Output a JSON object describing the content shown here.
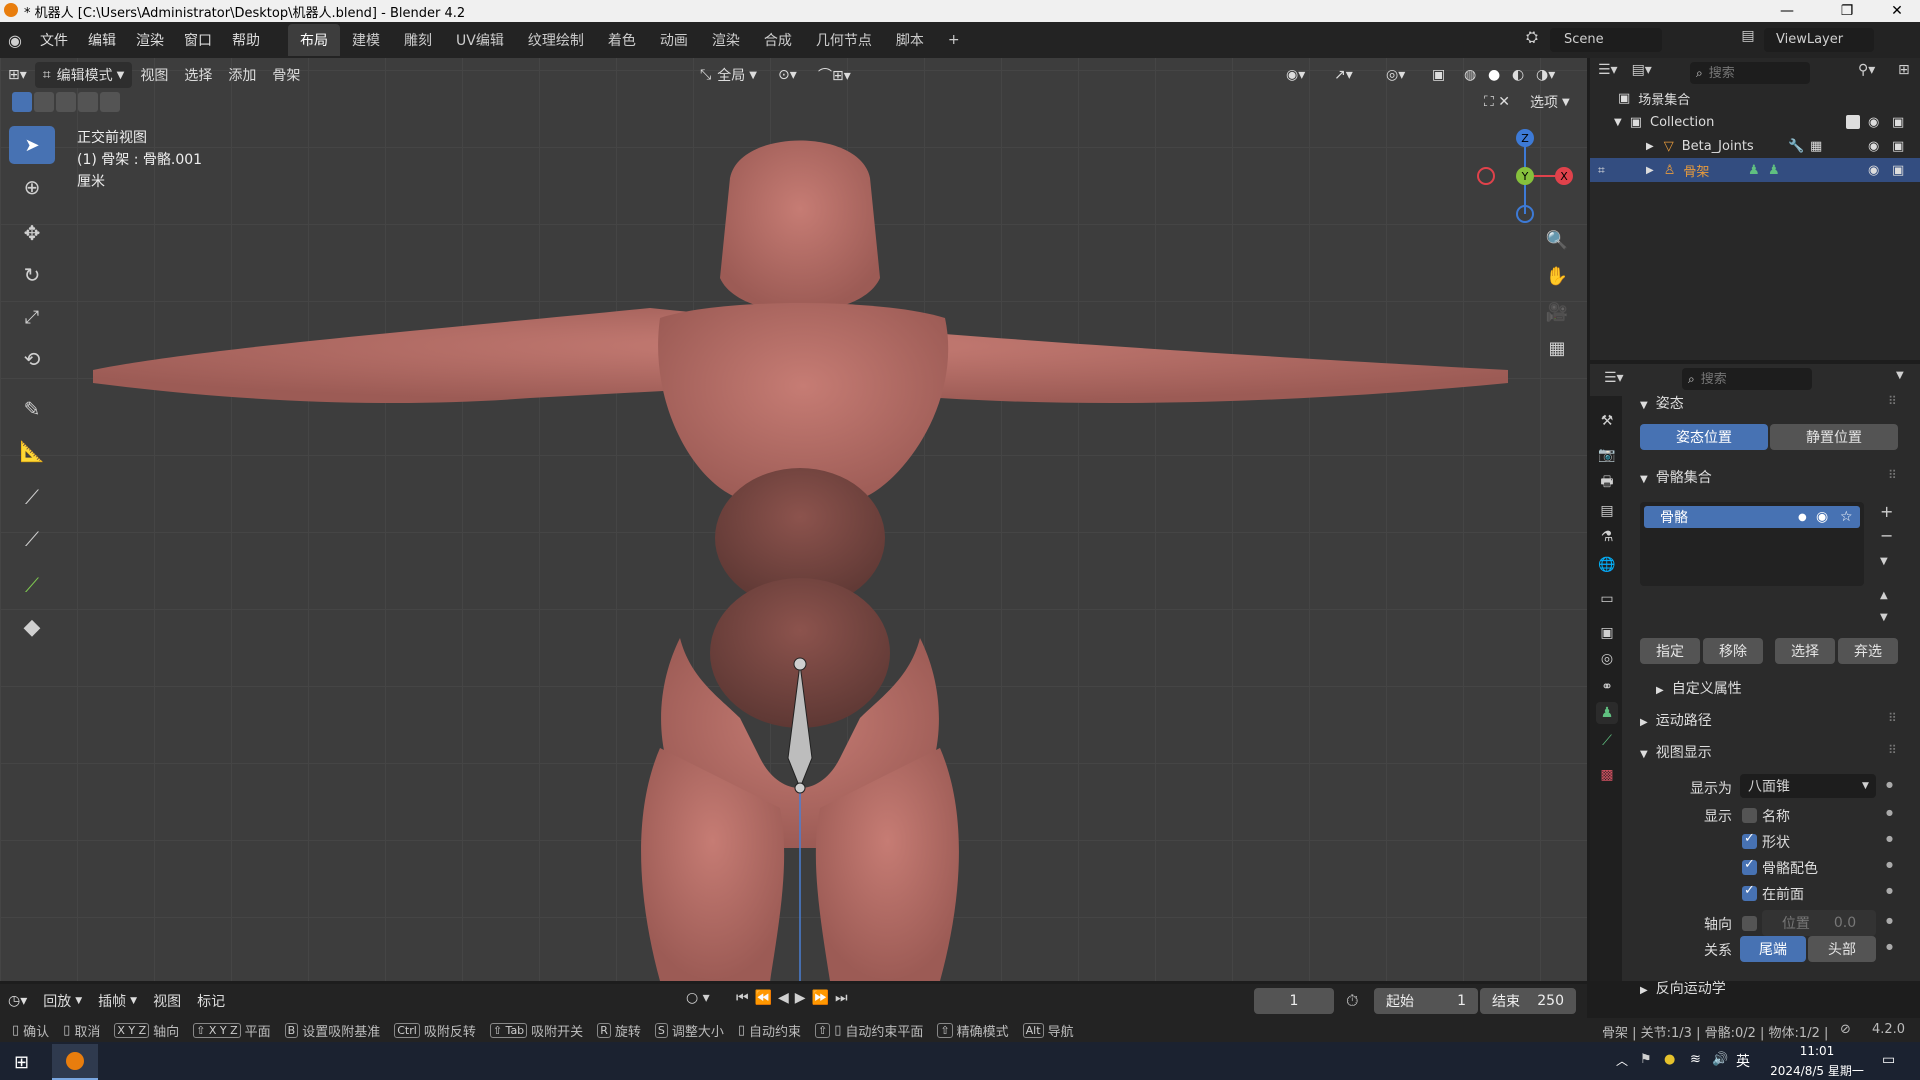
{
  "window": {
    "title": "* 机器人 [C:\\Users\\Administrator\\Desktop\\机器人.blend] - Blender 4.2",
    "min": "—",
    "max": "❐",
    "close": "✕"
  },
  "menus": [
    "文件",
    "编辑",
    "渲染",
    "窗口",
    "帮助"
  ],
  "workspaces": [
    "布局",
    "建模",
    "雕刻",
    "UV编辑",
    "纹理绘制",
    "着色",
    "动画",
    "渲染",
    "合成",
    "几何节点",
    "脚本"
  ],
  "workspace_add": "+",
  "scene": {
    "scene_name": "Scene",
    "view_layer": "ViewLayer"
  },
  "viewport_header": {
    "mode": "编辑模式",
    "menus": [
      "视图",
      "选择",
      "添加",
      "骨架"
    ],
    "transform_orientation": "全局",
    "options": "选项"
  },
  "viewport_info": {
    "view": "正交前视图",
    "selection": "(1) 骨架 : 骨骼.001",
    "units": "厘米"
  },
  "gizmo_axes": {
    "z": "Z",
    "y": "Y",
    "x": "X"
  },
  "outliner": {
    "search_placeholder": "搜索",
    "root": "场景集合",
    "collection": "Collection",
    "items": [
      {
        "name": "Beta_Joints",
        "type": "mesh"
      },
      {
        "name": "骨架",
        "type": "armature",
        "selected": true
      }
    ]
  },
  "properties": {
    "search_placeholder": "搜索",
    "pose_section": "姿态",
    "pose_position": "姿态位置",
    "rest_position": "静置位置",
    "bone_collections_section": "骨骼集合",
    "bone_collection_item": "骨骼",
    "assign": "指定",
    "remove": "移除",
    "select": "选择",
    "deselect": "弃选",
    "custom_props": "自定义属性",
    "motion_paths": "运动路径",
    "viewport_display": "视图显示",
    "display_as_label": "显示为",
    "display_as_value": "八面锥",
    "show_label": "显示",
    "show_names": "名称",
    "show_shapes": "形状",
    "show_bone_colors": "骨骼配色",
    "in_front": "在前面",
    "axes_label": "轴向",
    "axes_position_label": "位置",
    "axes_position_value": "0.0",
    "relation_label": "关系",
    "relation_tail": "尾端",
    "relation_head": "头部",
    "inverse_kinematics": "反向运动学",
    "checkboxes": {
      "names": false,
      "shapes": true,
      "bone_colors": true,
      "in_front": true,
      "axes": false
    }
  },
  "timeline": {
    "menus": [
      "回放",
      "插帧",
      "视图",
      "标记"
    ],
    "current_frame": "1",
    "start_label": "起始",
    "start": "1",
    "end_label": "结束",
    "end": "250"
  },
  "status": {
    "hints": [
      {
        "k": "",
        "t": "确认"
      },
      {
        "k": "",
        "t": "取消"
      },
      {
        "k": "X Y Z",
        "t": "轴向"
      },
      {
        "k": "⇧ X Y Z",
        "t": "平面"
      },
      {
        "k": "B",
        "t": "设置吸附基准"
      },
      {
        "k": "Ctrl",
        "t": "吸附反转"
      },
      {
        "k": "⇧ Tab",
        "t": "吸附开关"
      },
      {
        "k": "R",
        "t": "旋转"
      },
      {
        "k": "S",
        "t": "调整大小"
      },
      {
        "k": "",
        "t": "自动约束"
      },
      {
        "k": "⇧",
        "t": "自动约束平面"
      },
      {
        "k": "⇧",
        "t": "精确模式"
      },
      {
        "k": "Alt",
        "t": "导航"
      }
    ],
    "stats": "骨架 | 关节:1/3 | 骨骼:0/2 | 物体:1/2 |",
    "version": "4.2.0"
  },
  "taskbar": {
    "lang": "英",
    "time": "11:01",
    "date": "2024/8/5 星期一"
  },
  "colors": {
    "accent": "#4772b3",
    "skin": "#b9716a",
    "axis_x": "#e0424b",
    "axis_y": "#86c13c",
    "axis_z": "#3d7ad6"
  }
}
